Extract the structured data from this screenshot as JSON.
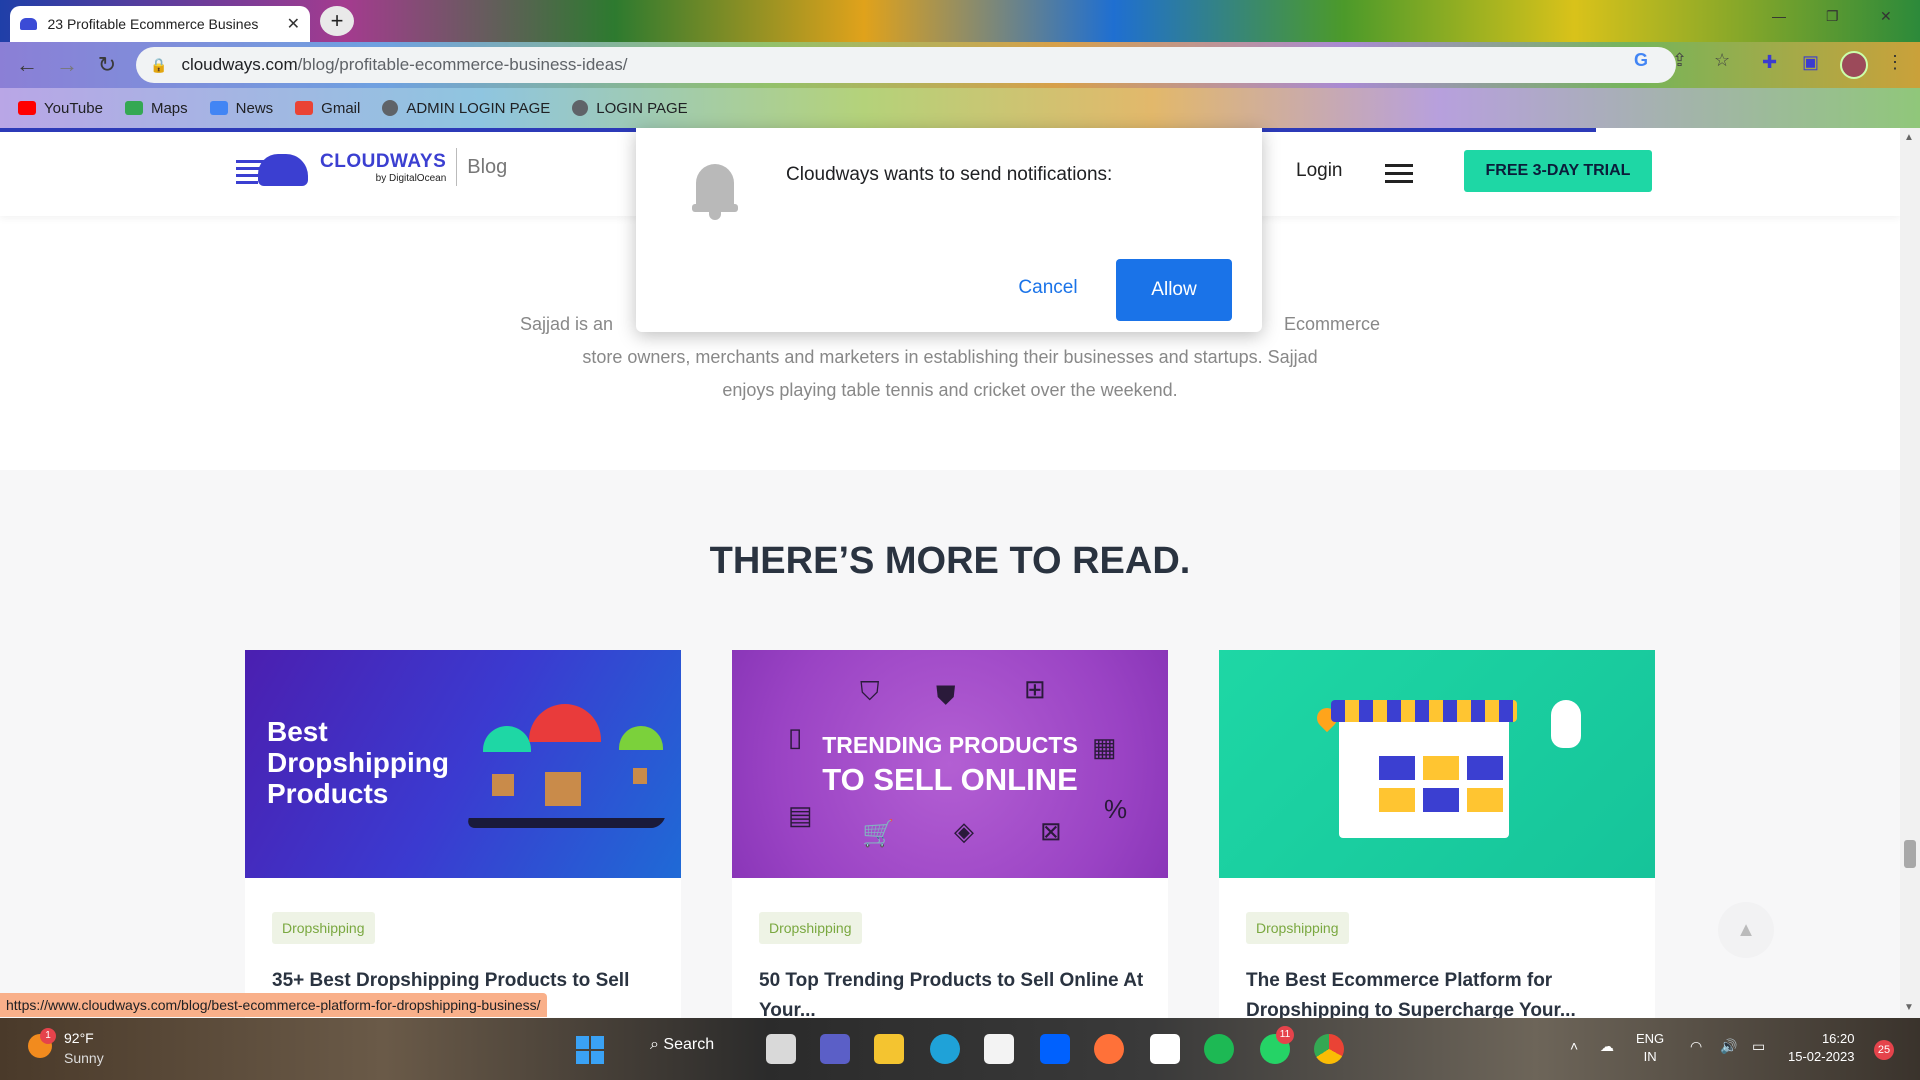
{
  "browser": {
    "tab_title": "23 Profitable Ecommerce Busines",
    "tab_close": "✕",
    "new_tab": "+",
    "url_domain": "cloudways.com",
    "url_path": "/blog/profitable-ecommerce-business-ideas/",
    "bookmarks": [
      {
        "label": "YouTube",
        "icon": "youtube-icon",
        "color": "#ff0000"
      },
      {
        "label": "Maps",
        "icon": "maps-icon",
        "color": "#34a853"
      },
      {
        "label": "News",
        "icon": "news-icon",
        "color": "#4285f4"
      },
      {
        "label": "Gmail",
        "icon": "gmail-icon",
        "color": "#ea4335"
      },
      {
        "label": "ADMIN LOGIN PAGE",
        "icon": "globe-icon",
        "color": "#5f6368"
      },
      {
        "label": "LOGIN PAGE",
        "icon": "globe-icon",
        "color": "#5f6368"
      }
    ]
  },
  "site": {
    "brand": "CLOUDWAYS",
    "brand_sub": "by DigitalOcean",
    "section": "Blog",
    "login": "Login",
    "trial_button": "FREE 3-DAY TRIAL",
    "accent_color": "#1ed7a5",
    "brand_color": "#3b3fd1"
  },
  "bio": {
    "text_a": "Sajjad is an",
    "text_b": "Ecommerce",
    "text_c": "store owners, merchants and marketers in establishing their businesses and startups. Sajjad",
    "text_d": "enjoys playing table tennis and cricket over the weekend."
  },
  "more": {
    "title": "THERE’S MORE TO READ.",
    "cards": [
      {
        "tag": "Dropshipping",
        "title": "35+ Best Dropshipping Products to Sell",
        "thumb_text": [
          "Best",
          "Dropshipping",
          "Products"
        ]
      },
      {
        "tag": "Dropshipping",
        "title": "50 Top Trending Products to Sell Online At Your...",
        "thumb_text": [
          "TRENDING PRODUCTS",
          "TO SELL ONLINE"
        ]
      },
      {
        "tag": "Dropshipping",
        "title": "The Best Ecommerce Platform for Dropshipping to Supercharge Your..."
      }
    ]
  },
  "notification": {
    "message": "Cloudways wants to send notifications:",
    "cancel": "Cancel",
    "allow": "Allow"
  },
  "status_url": "https://www.cloudways.com/blog/best-ecommerce-platform-for-dropshipping-business/",
  "taskbar": {
    "weather_badge": "1",
    "temp": "92°F",
    "condition": "Sunny",
    "search": "Search",
    "whatsapp_badge": "11",
    "lang_1": "ENG",
    "lang_2": "IN",
    "time": "16:20",
    "date": "15-02-2023",
    "notification_count": "25"
  }
}
